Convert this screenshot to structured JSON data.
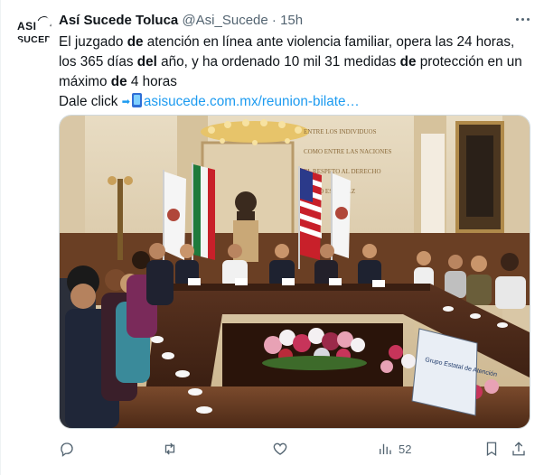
{
  "author": {
    "name": "Así Sucede Toluca",
    "handle": "@Asi_Sucede",
    "separator": "·",
    "time": "15h",
    "avatar_line1": "ASI",
    "avatar_line2": "SUCEDE"
  },
  "tweet": {
    "segments": [
      {
        "text": "El juzgado ",
        "bold": false
      },
      {
        "text": "de",
        "bold": true
      },
      {
        "text": " atención en línea ante violencia familiar, opera las 24 horas, los 365 días ",
        "bold": false
      },
      {
        "text": "del",
        "bold": true
      },
      {
        "text": " año, y ha ordenado 10 mil 31 medidas ",
        "bold": false
      },
      {
        "text": "de",
        "bold": true
      },
      {
        "text": " protección en un máximo ",
        "bold": false
      },
      {
        "text": "de",
        "bold": true
      },
      {
        "text": " 4 horas",
        "bold": false
      }
    ],
    "cta": "Dale click ",
    "link_text": "asisucede.com.mx/reunion-bilate…"
  },
  "media": {
    "banner_text": "Grupo Estatal de Atención",
    "wall_text": "ENTRE LOS INDIVIDUOS COMO ENTRE LAS NACIONES EL RESPETO AL DERECHO AJENO ES LA PAZ"
  },
  "actions": {
    "reply_icon": "reply-icon",
    "retweet_icon": "retweet-icon",
    "like_icon": "like-icon",
    "views_icon": "views-icon",
    "views_count": "52",
    "bookmark_icon": "bookmark-icon",
    "share_icon": "share-icon"
  },
  "colors": {
    "link": "#1d9bf0",
    "muted": "#536471",
    "text": "#0f1419"
  }
}
